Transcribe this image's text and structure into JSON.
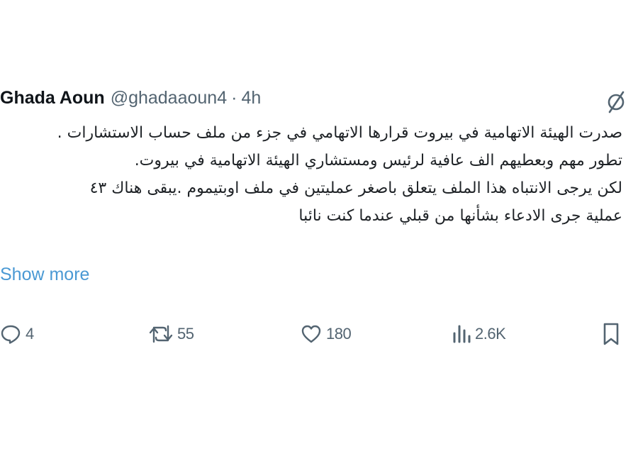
{
  "tweet": {
    "author_name": "Ghada Aoun",
    "author_handle": "@ghadaaoun4",
    "separator": "·",
    "timestamp": "4h",
    "lines": [
      "صدرت الهيئة الاتهامية في بيروت قرارها الاتهامي في جزء من ملف حساب الاستشارات .",
      "تطور مهم وبعطيهم الف عافية لرئيس ومستشاري الهيئة الاتهامية في بيروت.",
      "لكن يرجى الانتباه هذا الملف يتعلق باصغر عمليتين في ملف اوبتيموم .يبقى هناك ٤٣",
      "عملية جرى الادعاء بشأنها من قبلي عندما كنت نائبا"
    ],
    "show_more": "Show more"
  },
  "actions": {
    "reply_count": "4",
    "retweet_count": "55",
    "like_count": "180",
    "views_count": "2.6K"
  },
  "icons": {
    "grok": "grok-icon",
    "reply": "reply-icon",
    "retweet": "retweet-icon",
    "like": "heart-icon",
    "views": "views-icon",
    "bookmark": "bookmark-icon"
  },
  "colors": {
    "text": "#0f1419",
    "secondary": "#536471",
    "link": "#4a99d4"
  }
}
